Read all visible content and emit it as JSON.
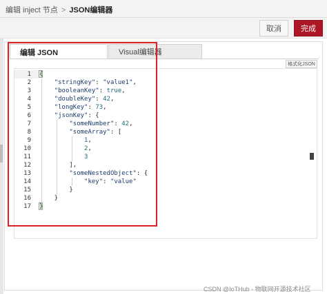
{
  "breadcrumb": {
    "parent": "编辑 inject 节点",
    "separator": ">",
    "current": "JSON编辑器"
  },
  "toolbar": {
    "cancel_label": "取消",
    "done_label": "完成"
  },
  "tabs": [
    {
      "label": "编辑 JSON",
      "active": true
    },
    {
      "label": "Visual编辑器",
      "active": false
    }
  ],
  "format_button_label": "格式化JSON",
  "editor": {
    "line_numbers": [
      "1",
      "2",
      "3",
      "4",
      "5",
      "6",
      "7",
      "8",
      "9",
      "10",
      "11",
      "12",
      "13",
      "14",
      "15",
      "16",
      "17"
    ],
    "lines": [
      "{",
      "    \"stringKey\": \"value1\",",
      "    \"booleanKey\": true,",
      "    \"doubleKey\": 42,",
      "    \"longKey\": 73,",
      "    \"jsonKey\": {",
      "        \"someNumber\": 42,",
      "        \"someArray\": [",
      "            1,",
      "            2,",
      "            3",
      "        ],",
      "        \"someNestedObject\": {",
      "            \"key\": \"value\"",
      "        }",
      "    }",
      "}"
    ]
  },
  "watermark": "CSDN @IoTHub - 物联网开源技术社区",
  "colors": {
    "accent": "#ad1625",
    "highlight_border": "#e02020"
  },
  "icons": [
    "fold-icon"
  ]
}
